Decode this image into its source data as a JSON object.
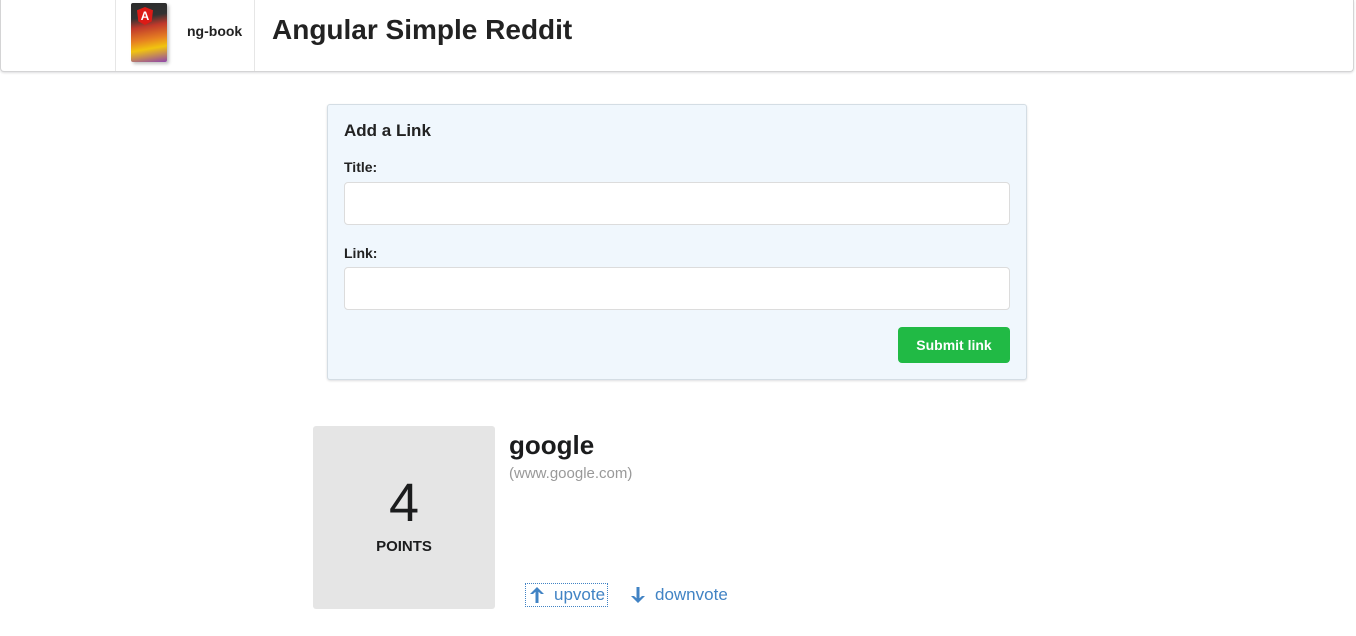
{
  "header": {
    "brand": "ng-book",
    "cover_badge": "A",
    "title": "Angular Simple Reddit"
  },
  "form": {
    "heading": "Add a Link",
    "title_label": "Title:",
    "title_value": "",
    "link_label": "Link:",
    "link_value": "",
    "submit_label": "Submit link"
  },
  "articles": [
    {
      "votes": "4",
      "votes_label": "POINTS",
      "title": "google",
      "domain": "(www.google.com)",
      "upvote_label": "upvote",
      "downvote_label": "downvote"
    }
  ],
  "icons": {
    "upvote": "arrow-up-icon",
    "downvote": "arrow-down-icon"
  },
  "colors": {
    "submit": "#21ba45",
    "link": "#4183c4",
    "form_bg": "#f0f7fd",
    "votes_bg": "#e5e5e5"
  }
}
